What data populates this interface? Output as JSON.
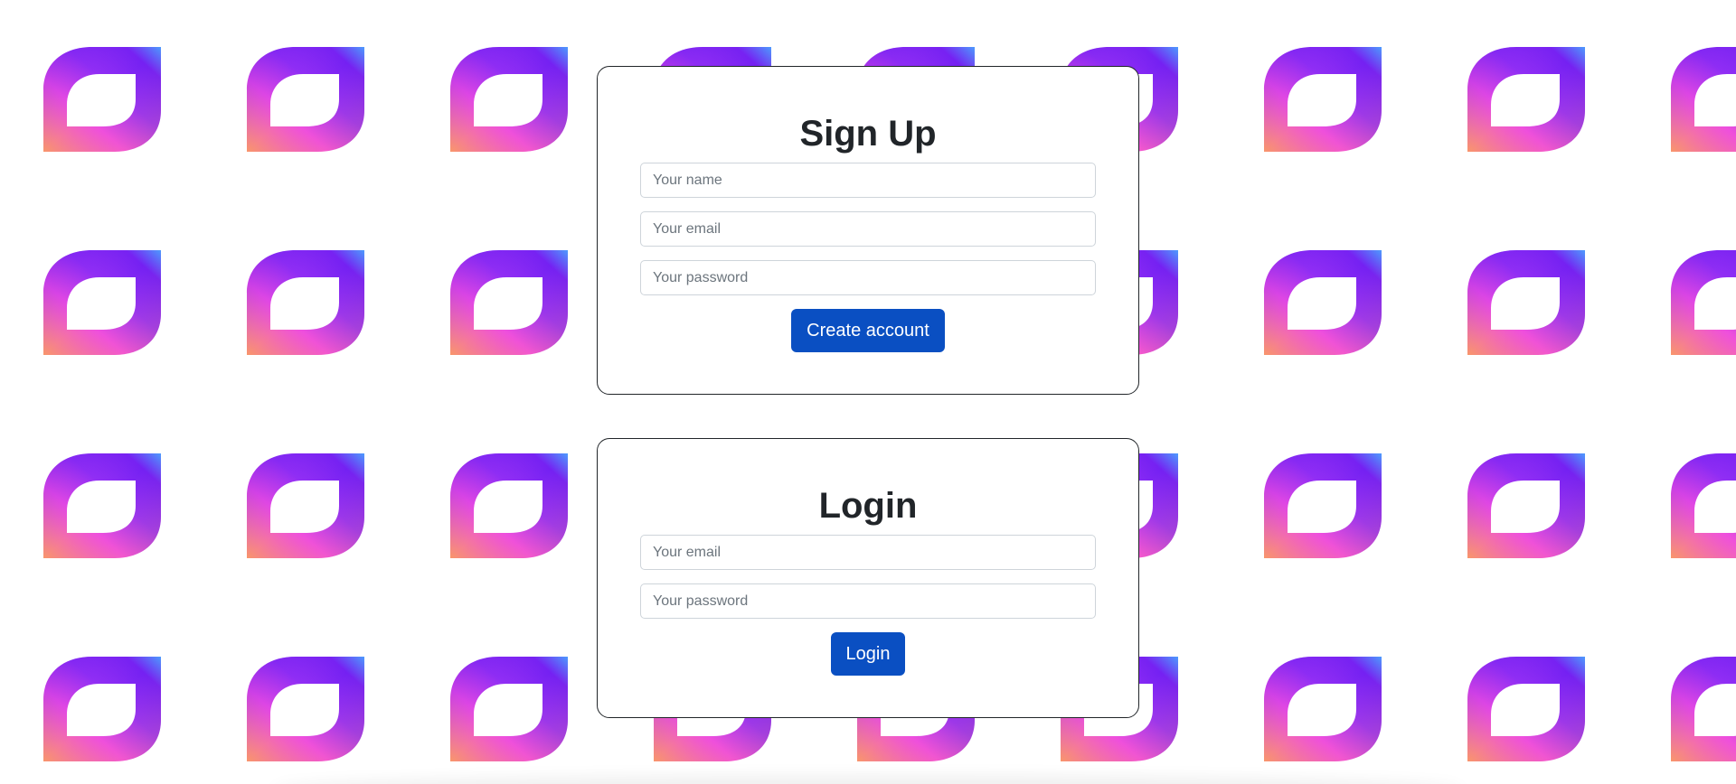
{
  "background": {
    "icon": "leaf-logo-icon",
    "colors": {
      "purple": "#6a1cf2",
      "magenta": "#f44de0",
      "blue": "#3ea6ff",
      "orange": "#ffa05a"
    }
  },
  "signup": {
    "title": "Sign Up",
    "name_placeholder": "Your name",
    "email_placeholder": "Your email",
    "password_placeholder": "Your password",
    "submit_label": "Create account"
  },
  "login": {
    "title": "Login",
    "email_placeholder": "Your email",
    "password_placeholder": "Your password",
    "submit_label": "Login"
  },
  "theme": {
    "primary": "#0a4fc2",
    "text": "#212529",
    "card_border": "#212529",
    "input_border": "#ced4da"
  }
}
